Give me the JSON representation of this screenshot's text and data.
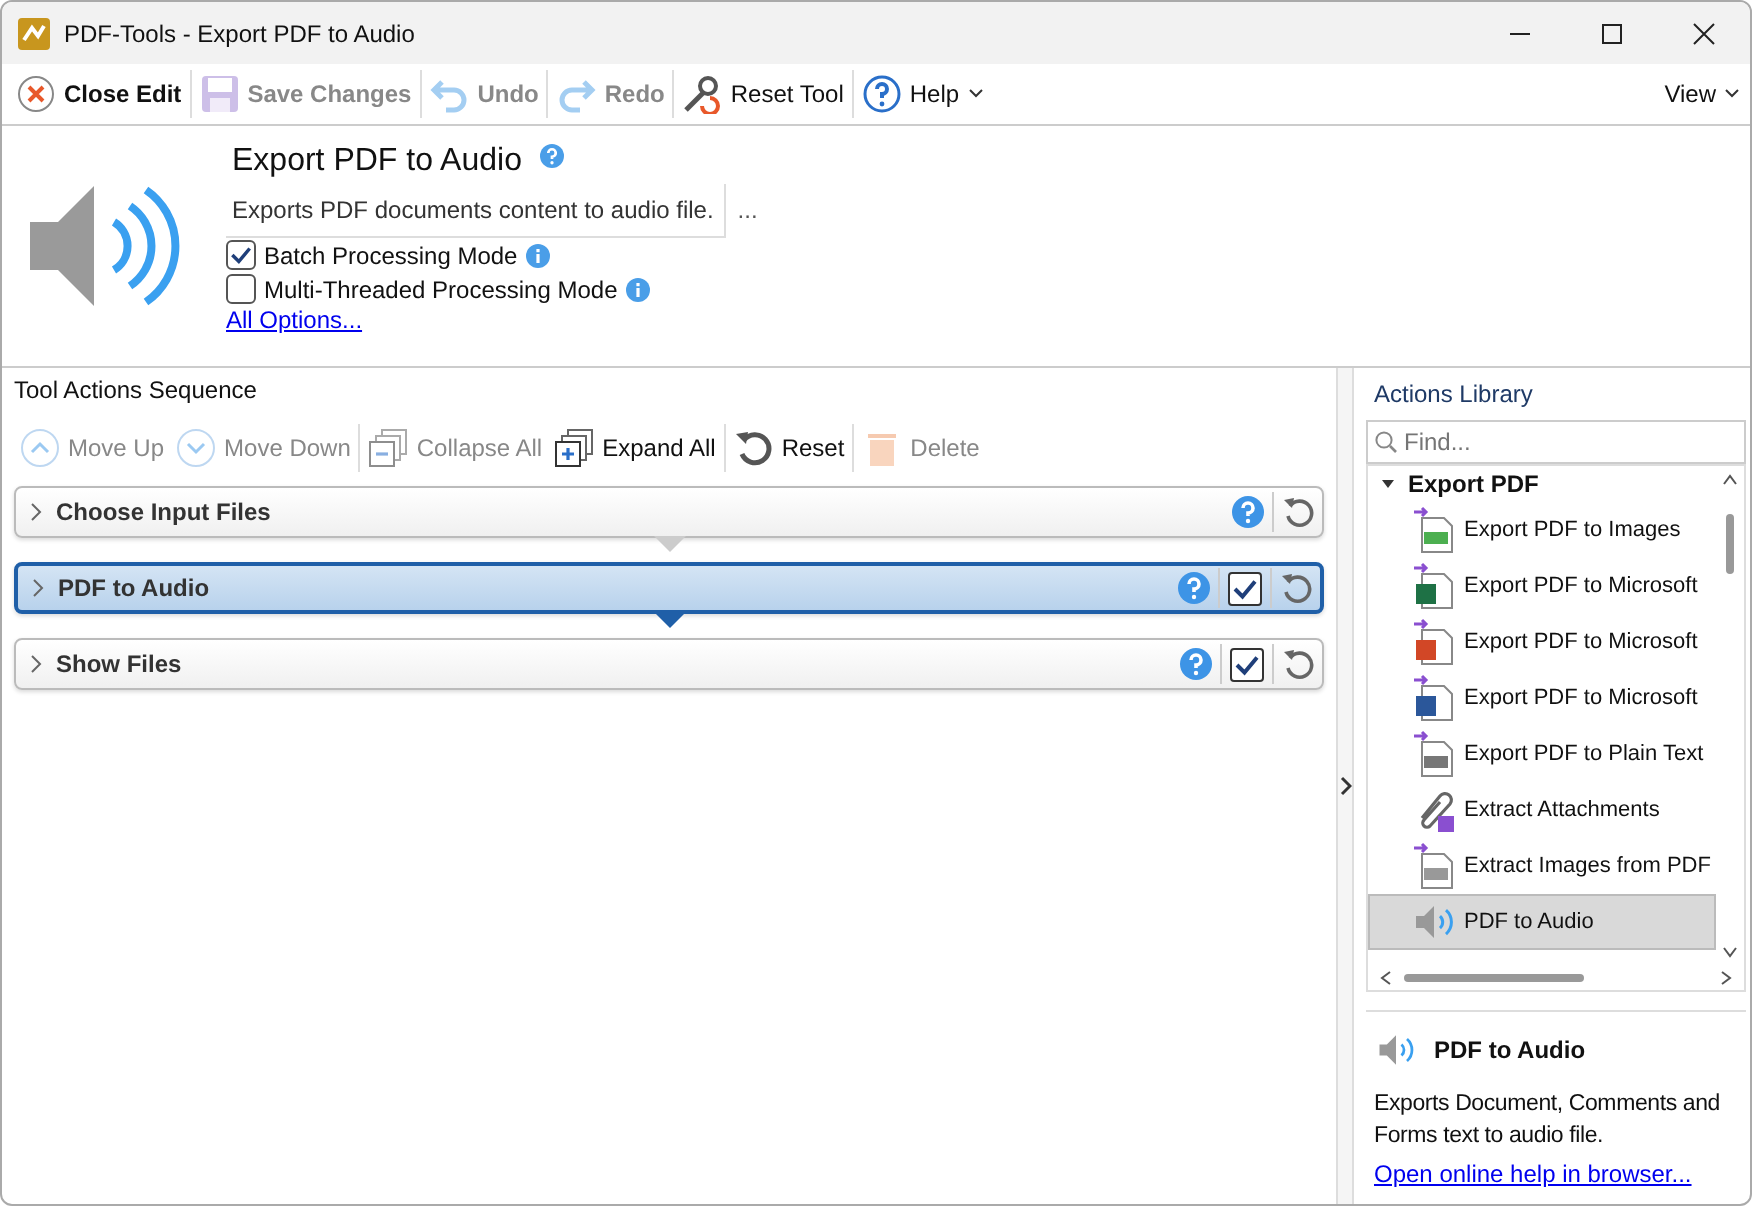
{
  "window": {
    "title": "PDF-Tools - Export PDF to Audio"
  },
  "toolbar": [
    {
      "kind": "close",
      "label": "Close Edit",
      "disabled": false
    },
    {
      "kind": "save",
      "label": "Save Changes",
      "disabled": true
    },
    {
      "kind": "undo",
      "label": "Undo",
      "disabled": true
    },
    {
      "kind": "redo",
      "label": "Redo",
      "disabled": true
    },
    {
      "kind": "reset",
      "label": "Reset Tool",
      "disabled": false
    },
    {
      "kind": "help",
      "label": "Help",
      "disabled": false
    }
  ],
  "view_menu": "View",
  "tool": {
    "title": "Export PDF to Audio",
    "description": "Exports PDF documents content to audio file.",
    "more": "...",
    "options": [
      {
        "label": "Batch Processing Mode",
        "checked": true
      },
      {
        "label": "Multi-Threaded Processing Mode",
        "checked": false
      }
    ],
    "all_options": "All Options..."
  },
  "sequence": {
    "title": "Tool Actions Sequence",
    "buttons": [
      {
        "kind": "up",
        "label": "Move Up",
        "disabled": true
      },
      {
        "kind": "down",
        "label": "Move Down",
        "disabled": true
      },
      {
        "kind": "collapse",
        "label": "Collapse All",
        "disabled": true
      },
      {
        "kind": "expand",
        "label": "Expand All",
        "disabled": false
      },
      {
        "kind": "reset",
        "label": "Reset",
        "disabled": false
      },
      {
        "kind": "delete",
        "label": "Delete",
        "disabled": true
      }
    ],
    "actions": [
      {
        "label": "Choose Input Files",
        "selected": false
      },
      {
        "label": "PDF to Audio",
        "selected": true,
        "checked": true
      },
      {
        "label": "Show Files",
        "selected": false,
        "checked": true
      }
    ]
  },
  "library": {
    "title": "Actions Library",
    "search": {
      "placeholder": "Find..."
    },
    "group": "Export PDF",
    "items": [
      {
        "kind": "images",
        "label": "Export PDF to Images",
        "selected": false
      },
      {
        "kind": "excel",
        "label": "Export PDF to Microsoft",
        "selected": false
      },
      {
        "kind": "powerpoint",
        "label": "Export PDF to Microsoft",
        "selected": false
      },
      {
        "kind": "word",
        "label": "Export PDF to Microsoft",
        "selected": false
      },
      {
        "kind": "text",
        "label": "Export PDF to Plain Text",
        "selected": false
      },
      {
        "kind": "attach",
        "label": "Extract Attachments",
        "selected": false
      },
      {
        "kind": "extract",
        "label": "Extract Images from PDF",
        "selected": false
      },
      {
        "kind": "audio",
        "label": "PDF to Audio",
        "selected": true
      }
    ],
    "details": {
      "title": "PDF to Audio",
      "description": "Exports Document, Comments and Forms text to audio file.",
      "link": "Open online help in browser..."
    }
  }
}
